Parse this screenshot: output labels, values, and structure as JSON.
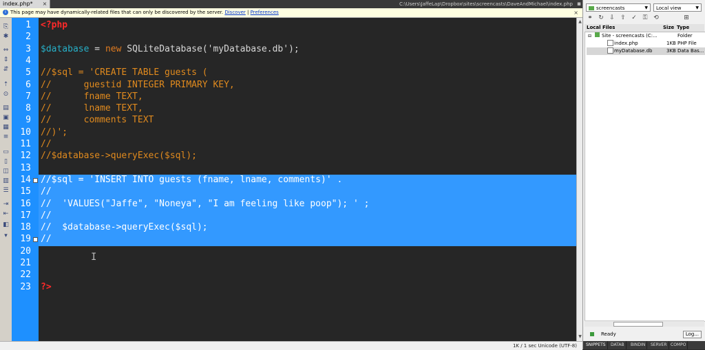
{
  "document_tab": {
    "label": "index.php*",
    "close": "×"
  },
  "file_path": "C:\\Users\\JaffeLap\\Dropbox\\sites\\screencasts\\DaveAndMichael\\index.php",
  "infobar": {
    "message": "This page may have dynamically-related files that can only be discovered by the server.",
    "discover": "Discover",
    "separator": "|",
    "preferences": "Preferences",
    "close": "×"
  },
  "editor": {
    "line_numbers": [
      "1",
      "2",
      "3",
      "4",
      "5",
      "6",
      "7",
      "8",
      "9",
      "10",
      "11",
      "12",
      "13",
      "14",
      "15",
      "16",
      "17",
      "18",
      "19",
      "20",
      "21",
      "22",
      "23"
    ],
    "lines": [
      [
        {
          "t": "<?php",
          "c": "tag"
        }
      ],
      [],
      [
        {
          "t": "$database",
          "c": "var"
        },
        {
          "t": " = ",
          "c": "plain"
        },
        {
          "t": "new",
          "c": "kw"
        },
        {
          "t": " SQLiteDatabase(",
          "c": "plain"
        },
        {
          "t": "'myDatabase.db'",
          "c": "str"
        },
        {
          "t": ");",
          "c": "plain"
        }
      ],
      [],
      [
        {
          "t": "//$sql = 'CREATE TABLE guests (",
          "c": "comment"
        }
      ],
      [
        {
          "t": "//      guestid INTEGER PRIMARY KEY,",
          "c": "comment"
        }
      ],
      [
        {
          "t": "//      fname TEXT,",
          "c": "comment"
        }
      ],
      [
        {
          "t": "//      lname TEXT,",
          "c": "comment"
        }
      ],
      [
        {
          "t": "//      comments TEXT",
          "c": "comment"
        }
      ],
      [
        {
          "t": "//)';",
          "c": "comment"
        }
      ],
      [
        {
          "t": "//",
          "c": "comment"
        }
      ],
      [
        {
          "t": "//$database->queryExec($sql);",
          "c": "comment"
        }
      ],
      [],
      [
        {
          "t": "//$sql = 'INSERT INTO guests (fname, lname, comments)' .",
          "c": "selected"
        }
      ],
      [
        {
          "t": "//",
          "c": "selected"
        }
      ],
      [
        {
          "t": "//  'VALUES(\"Jaffe\", \"Noneya\", \"I am feeling like poop\"); ' ;",
          "c": "selected"
        }
      ],
      [
        {
          "t": "//",
          "c": "selected"
        }
      ],
      [
        {
          "t": "//  $database->queryExec($sql);",
          "c": "selected"
        }
      ],
      [
        {
          "t": "//",
          "c": "selected"
        }
      ],
      [],
      [],
      [],
      [
        {
          "t": "?>",
          "c": "tag"
        }
      ]
    ],
    "cursor_glyph": "I"
  },
  "status_bar": {
    "text": "1K / 1 sec  Unicode (UTF-8)"
  },
  "files_panel": {
    "site_select": "screencasts",
    "view_select": "Local view",
    "columns": {
      "name": "Local Files",
      "size": "Size",
      "type": "Type"
    },
    "rows": [
      {
        "name": "Site - screencasts (C:...",
        "size": "",
        "type": "Folder"
      },
      {
        "name": "index.php",
        "size": "1KB",
        "type": "PHP File"
      },
      {
        "name": "myDatabase.db",
        "size": "3KB",
        "type": "Data Bas..."
      }
    ],
    "status": "Ready",
    "log_button": "Log...",
    "bottom_tabs": [
      "SNIPPETS",
      "DATAB",
      "BINDIN",
      "SERVER",
      "COMPO"
    ]
  },
  "colors": {
    "tag": "#ff2a2a",
    "var": "#27b0c8",
    "kw": "#e07b20",
    "plain": "#d8d8d8",
    "str": "#d8d8d8",
    "comment": "#e08a1e",
    "selected": "#ffffff",
    "gutter": "#1e90ff",
    "selection": "#3399ff"
  }
}
